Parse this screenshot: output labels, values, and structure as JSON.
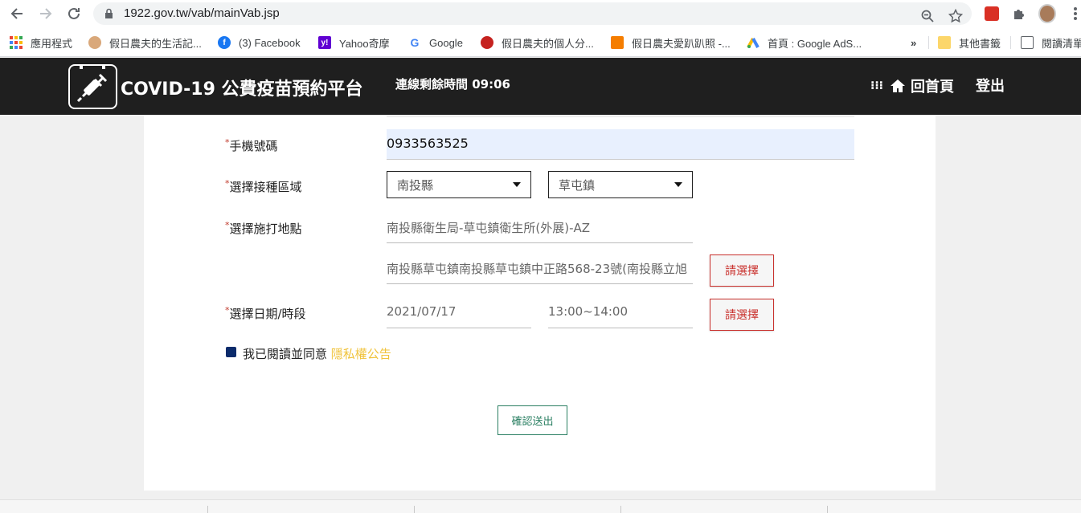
{
  "browser": {
    "url": "1922.gov.tw/vab/mainVab.jsp",
    "bookmarks": [
      {
        "label": "應用程式",
        "icon": "apps-grid-icon"
      },
      {
        "label": "假日農夫的生活記...",
        "icon": "farmer-avatar-icon"
      },
      {
        "label": "(3) Facebook",
        "icon": "facebook-icon"
      },
      {
        "label": "Yahoo奇摩",
        "icon": "yahoo-icon"
      },
      {
        "label": "Google",
        "icon": "google-icon"
      },
      {
        "label": "假日農夫的個人分...",
        "icon": "profile-icon"
      },
      {
        "label": "假日農夫愛趴趴照 -...",
        "icon": "blogger-icon"
      },
      {
        "label": "首頁 : Google AdS...",
        "icon": "google-ads-icon"
      }
    ],
    "overflow_label": "»",
    "other_bookmarks": "其他書籤",
    "reading_list": "閱讀清單"
  },
  "header": {
    "title": "COVID-19 公費疫苗預約平台",
    "countdown": "連線剩餘時間 09:06",
    "home_label": "回首頁",
    "logout_label": "登出"
  },
  "form": {
    "phone_label": "手機號碼",
    "phone_value": "0933563525",
    "area_label": "選擇接種區域",
    "county": "南投縣",
    "township": "草屯鎮",
    "site_label": "選擇施打地點",
    "site_name": "南投縣衛生局-草屯鎮衛生所(外展)-AZ",
    "site_address": "南投縣草屯鎮南投縣草屯鎮中正路568-23號(南投縣立旭",
    "choose_label": "請選擇",
    "date_label": "選擇日期/時段",
    "date_value": "2021/07/17",
    "time_value": "13:00~14:00",
    "agree_text": "我已閱讀並同意",
    "privacy_link": "隱私權公告",
    "submit_label": "確認送出",
    "required_mark": "*"
  },
  "colors": {
    "header_bg": "#1f1f1f",
    "required": "#c0392b",
    "choose_button": "#c9302c",
    "privacy_link": "#f0c33c",
    "submit_border": "#2a7f62",
    "checkbox": "#0b2b6b"
  }
}
